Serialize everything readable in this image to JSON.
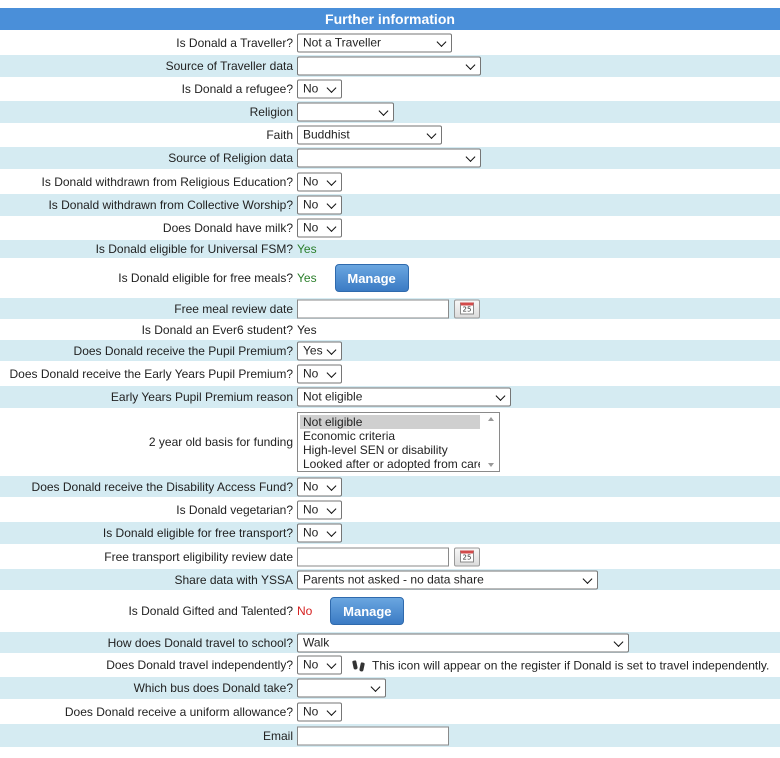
{
  "header": {
    "title": "Further information"
  },
  "fields": {
    "traveller": {
      "label": "Is Donald a Traveller?",
      "value": "Not a Traveller"
    },
    "traveller_source": {
      "label": "Source of Traveller data",
      "value": ""
    },
    "refugee": {
      "label": "Is Donald a refugee?",
      "value": "No"
    },
    "religion": {
      "label": "Religion",
      "value": ""
    },
    "faith": {
      "label": "Faith",
      "value": "Buddhist"
    },
    "religion_source": {
      "label": "Source of Religion data",
      "value": ""
    },
    "withdrawn_re": {
      "label": "Is Donald withdrawn from Religious Education?",
      "value": "No"
    },
    "withdrawn_cw": {
      "label": "Is Donald withdrawn from Collective Worship?",
      "value": "No"
    },
    "milk": {
      "label": "Does Donald have milk?",
      "value": "No"
    },
    "universal_fsm": {
      "label": "Is Donald eligible for Universal FSM?",
      "value": "Yes"
    },
    "free_meals": {
      "label": "Is Donald eligible for free meals?",
      "value": "Yes",
      "button": "Manage"
    },
    "meal_review": {
      "label": "Free meal review date",
      "value": "",
      "cal": "25"
    },
    "ever6": {
      "label": "Is Donald an Ever6 student?",
      "value": "Yes"
    },
    "pupil_premium": {
      "label": "Does Donald receive the Pupil Premium?",
      "value": "Yes"
    },
    "ey_pupil_premium": {
      "label": "Does Donald receive the Early Years Pupil Premium?",
      "value": "No"
    },
    "ey_reason": {
      "label": "Early Years Pupil Premium reason",
      "value": "Not eligible"
    },
    "two_year_basis": {
      "label": "2 year old basis for funding",
      "options": [
        "Not eligible",
        "Economic criteria",
        "High-level SEN or disability",
        "Looked after or adopted from care"
      ]
    },
    "disability_fund": {
      "label": "Does Donald receive the Disability Access Fund?",
      "value": "No"
    },
    "vegetarian": {
      "label": "Is Donald vegetarian?",
      "value": "No"
    },
    "free_transport": {
      "label": "Is Donald eligible for free transport?",
      "value": "No"
    },
    "transport_review": {
      "label": "Free transport eligibility review date",
      "value": "",
      "cal": "25"
    },
    "yssa": {
      "label": "Share data with YSSA",
      "value": "Parents not asked - no data share"
    },
    "gifted": {
      "label": "Is Donald Gifted and Talented?",
      "value": "No",
      "button": "Manage"
    },
    "travel_school": {
      "label": "How does Donald travel to school?",
      "value": "Walk"
    },
    "travel_indep": {
      "label": "Does Donald travel independently?",
      "value": "No",
      "note": "This icon will appear on the register if Donald is set to travel independently."
    },
    "bus": {
      "label": "Which bus does Donald take?",
      "value": ""
    },
    "uniform": {
      "label": "Does Donald receive a uniform allowance?",
      "value": "No"
    },
    "email": {
      "label": "Email",
      "value": ""
    }
  },
  "colors": {
    "header": "#4a8fd9",
    "row_alt": "#d5ebf2",
    "yes": "#2a7e2a",
    "no": "#d52020",
    "button": "#3b7bc4"
  }
}
